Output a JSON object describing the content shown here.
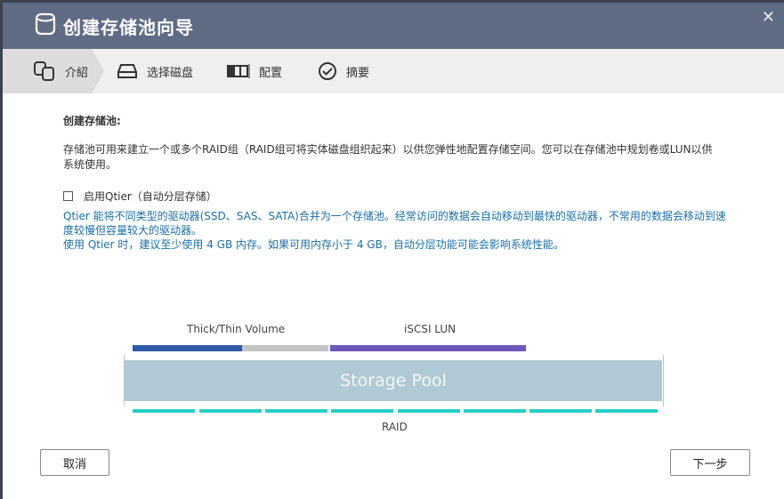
{
  "window": {
    "title": "创建存储池向导",
    "close": "✕"
  },
  "steps": [
    {
      "label": "介紹",
      "icon": "database-stack-icon"
    },
    {
      "label": "选择磁盘",
      "icon": "disk-drive-icon"
    },
    {
      "label": "配置",
      "icon": "raid-config-icon"
    },
    {
      "label": "摘要",
      "icon": "check-circle-icon"
    }
  ],
  "content": {
    "heading": "创建存储池:",
    "description": "存储池可用来建立一个或多个RAID组（RAID组可将实体磁盘组织起来）以供您弹性地配置存储空间。您可以在存储池中规划卷或LUN以供系统使用。",
    "qtier_label": "启用Qtier（自动分层存储）",
    "qtier_checked": false,
    "qtier_info1": "Qtier 能将不同类型的驱动器(SSD、SAS、SATA)合并为一个存储池。经常访问的数据会自动移动到最快的驱动器，不常用的数据会移动到速度较慢但容量较大的驱动器。",
    "qtier_info2": "使用 Qtier 时，建议至少使用 4 GB 内存。如果可用内存小于 4 GB，自动分层功能可能会影响系统性能。"
  },
  "diagram": {
    "volume_label": "Thick/Thin Volume",
    "lun_label": "iSCSI LUN",
    "pool_label": "Storage Pool",
    "raid_label": "RAID",
    "colors": {
      "volume": "#2e5aa8",
      "free": "#c4c4c4",
      "lun": "#6e58bd",
      "pool": "#b0c9d5",
      "raid": "#26d0c4"
    }
  },
  "buttons": {
    "cancel": "取消",
    "next": "下一步"
  }
}
